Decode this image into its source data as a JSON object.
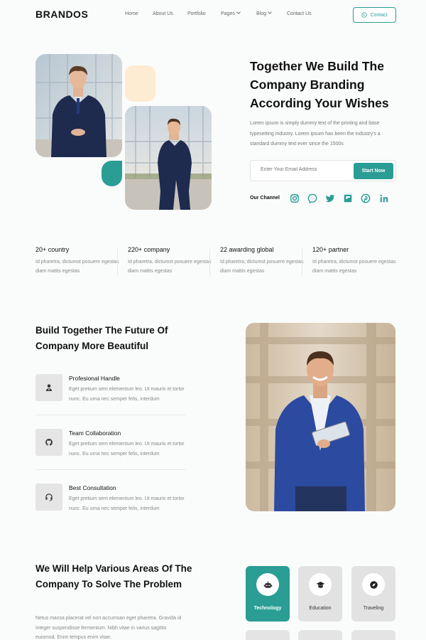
{
  "nav": {
    "brand": "BRANDOS",
    "items": [
      {
        "label": "Home"
      },
      {
        "label": "About Us"
      },
      {
        "label": "Portfolio"
      },
      {
        "label": "Pages"
      },
      {
        "label": "Blog"
      },
      {
        "label": "Contact Us"
      }
    ],
    "contact_label": "Contact"
  },
  "hero": {
    "title": "Together We Build The Company Branding According Your Wishes",
    "text": "Lorem ipsum is simply dummy text of the printing and base typesetting industry. Lorem ipsum has been the industry's a standard dummy text ever since the 1500s",
    "email_placeholder": "Enter Your Email Address",
    "cta_label": "Start Now",
    "channel_label": "Our Channel",
    "socials": [
      "instagram-icon",
      "messenger-icon",
      "twitter-icon",
      "flipboard-icon",
      "pinterest-icon",
      "linkedin-icon"
    ]
  },
  "stats": [
    {
      "title": "20+ country",
      "desc": "Id pharetra, dictumst posuere egestas diam mattis egestas"
    },
    {
      "title": "220+ company",
      "desc": "Id pharetra, dictumst posuere egestas diam mattis egestas"
    },
    {
      "title": "22 awarding global",
      "desc": "Id pharetra, dictumst posuere egestas diam mattis egestas"
    },
    {
      "title": "120+ partner",
      "desc": "Id pharetra, dictumst posuere egestas diam mattis egestas"
    }
  ],
  "features": {
    "title": "Build Together The Future Of Company More Beautiful",
    "items": [
      {
        "title": "Profesional Handle",
        "desc": "Eget pretium sem elementum leo. Ut mauris et tortor nunc. Eu urna nec semper felis, interdum"
      },
      {
        "title": "Team Collaboration",
        "desc": "Eget pretium sem elementum leo. Ut mauris et tortor nunc. Eu urna nec semper felis, interdum"
      },
      {
        "title": "Best Consultation",
        "desc": "Eget pretium sem elementum leo. Ut mauris et tortor nunc. Eu urna nec semper felis, interdum"
      }
    ]
  },
  "areas": {
    "title": "We Will Help Various Areas Of The Company To Solve The Problem",
    "text": "Netus massa placerat vel non accumsan eget pharetra. Gravida id integer suspendisse fermentum. Nibh vitae in varius sagittis euismod. Enim tempus enim vitae.",
    "categories": [
      {
        "label": "Technology",
        "icon": "robot-icon"
      },
      {
        "label": "Education",
        "icon": "graduation-cap-icon"
      },
      {
        "label": "Traveling",
        "icon": "compass-icon"
      }
    ]
  },
  "colors": {
    "accent": "#2a9d95",
    "peach": "#fdecd2"
  }
}
